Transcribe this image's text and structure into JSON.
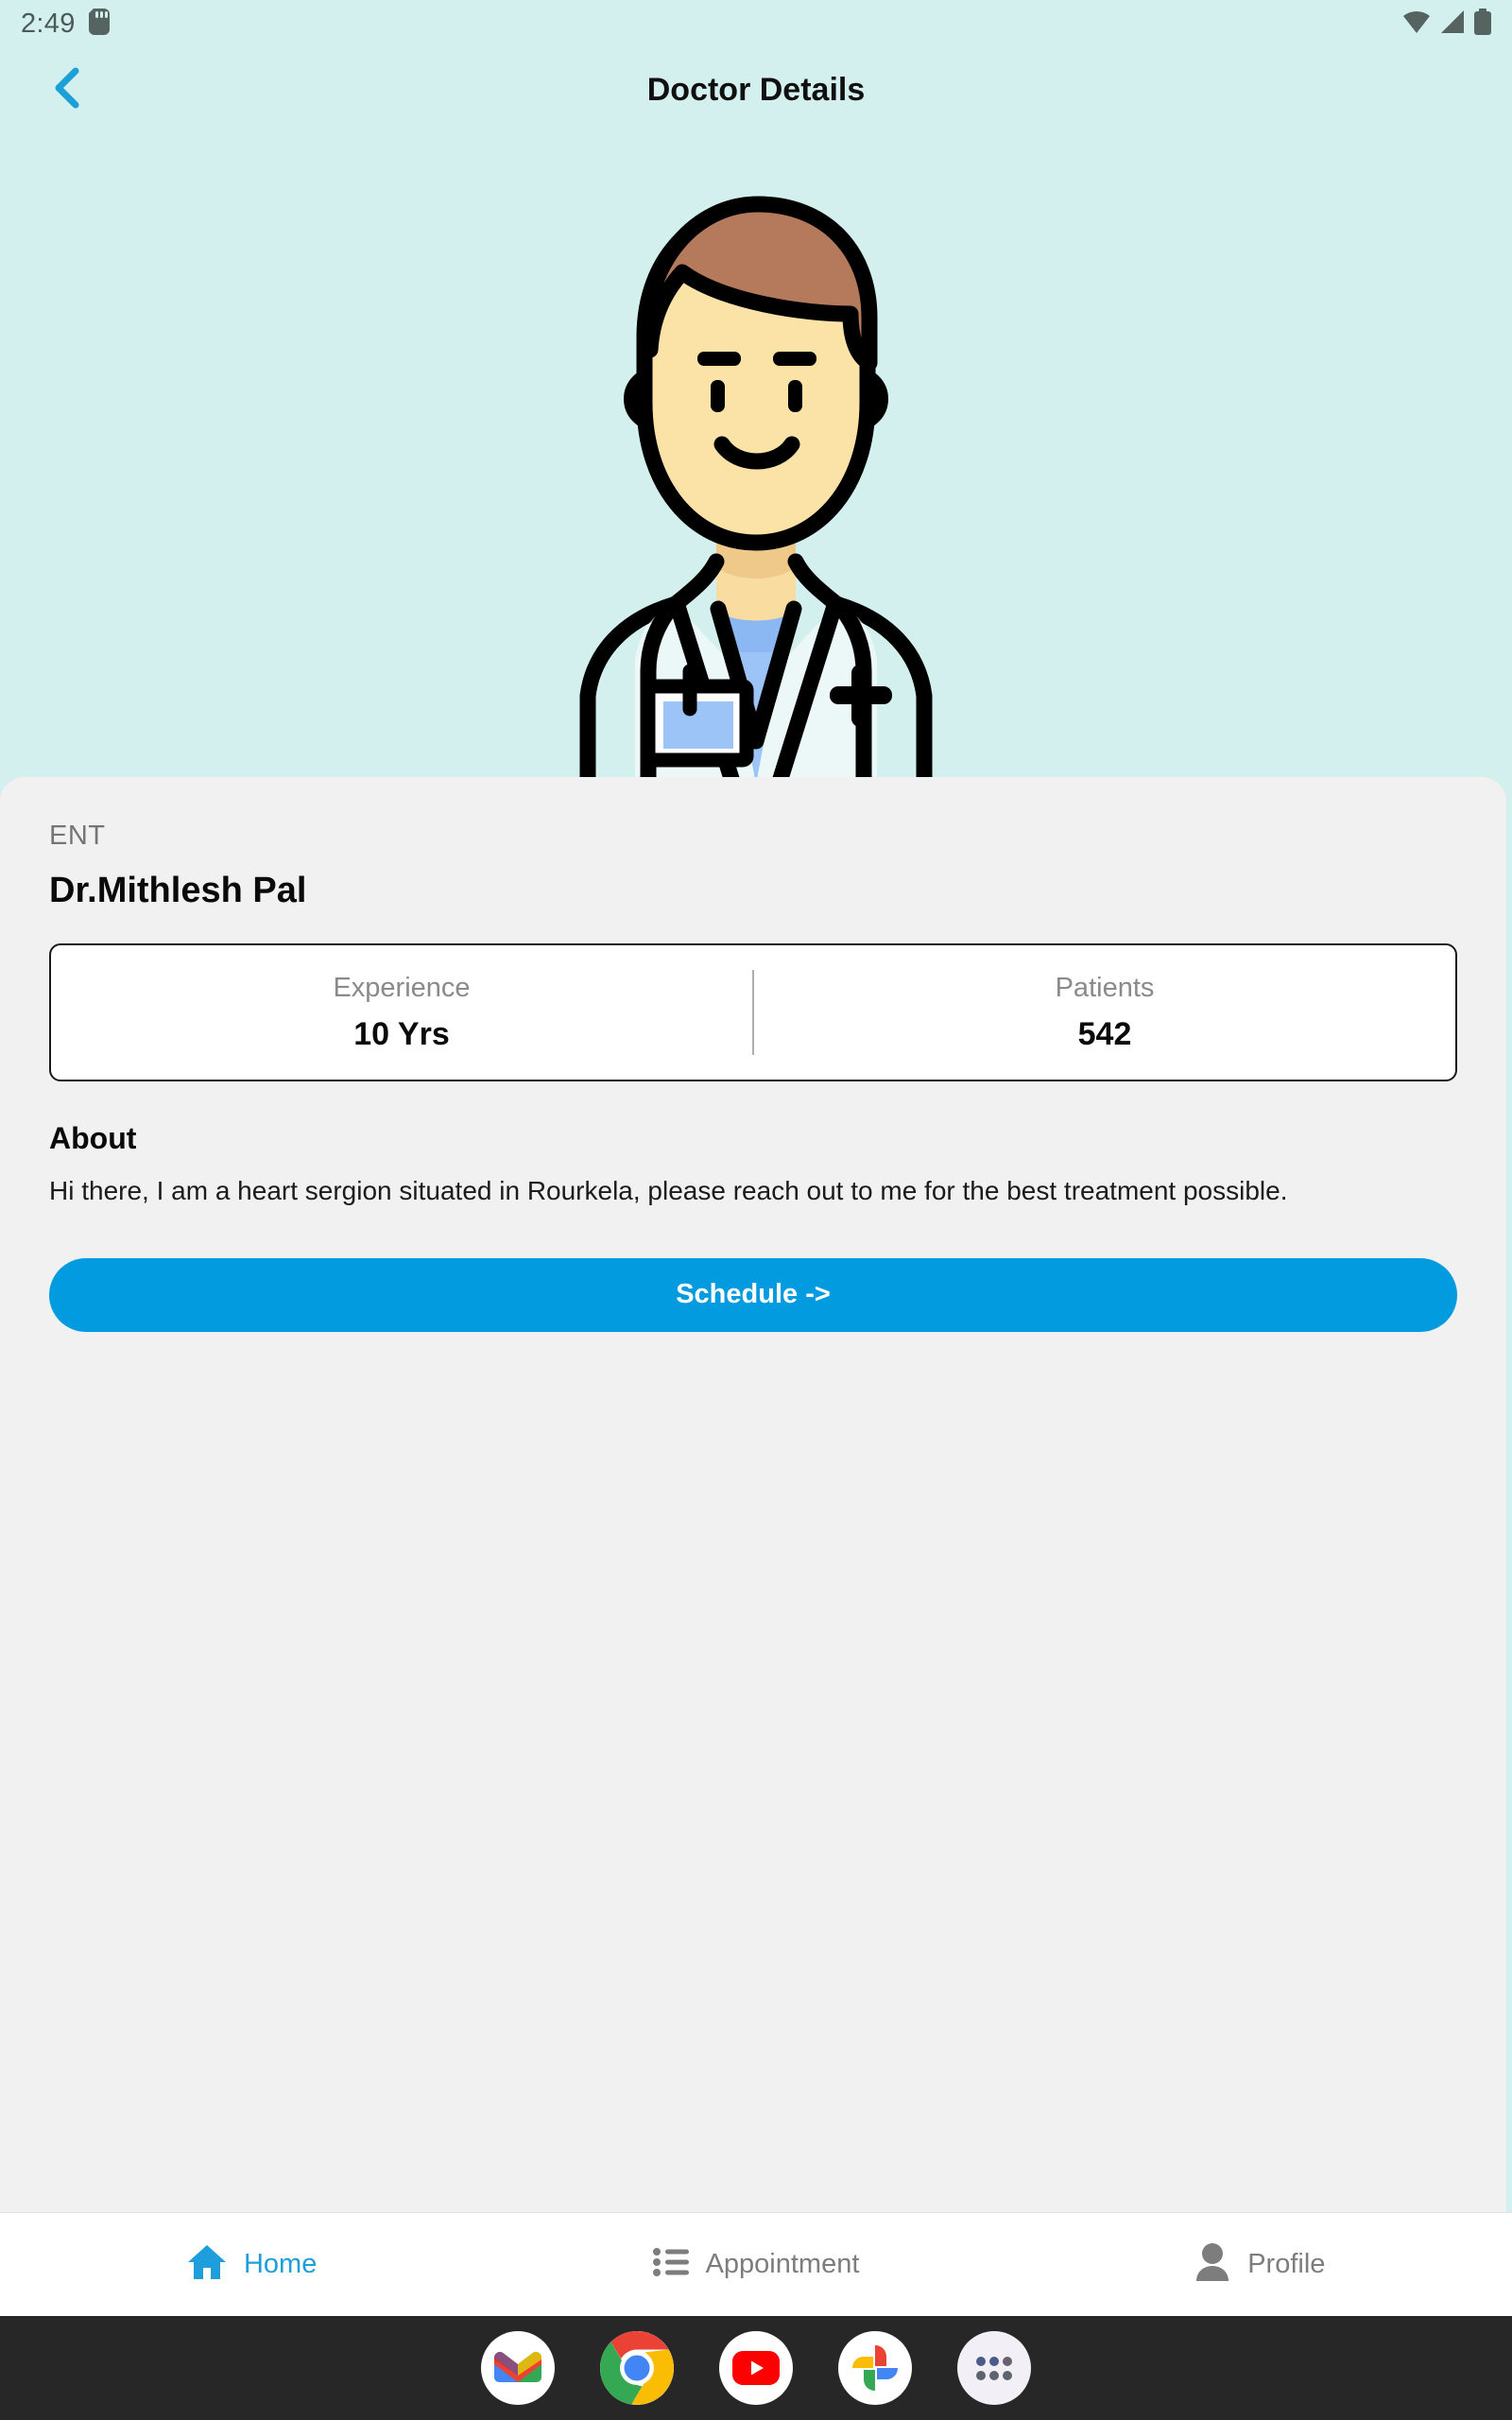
{
  "status_bar": {
    "time": "2:49",
    "icons": [
      "sd-card-icon",
      "wifi-icon",
      "signal-icon",
      "battery-icon"
    ]
  },
  "app_bar": {
    "title": "Doctor Details",
    "back_icon": "chevron-left-icon"
  },
  "hero": {
    "illustration": "doctor-avatar-illustration",
    "background_color": "#D4F0EE"
  },
  "detail": {
    "specialty": "ENT",
    "doctor_name": "Dr.Mithlesh Pal",
    "stats": [
      {
        "label": "Experience",
        "value": "10 Yrs"
      },
      {
        "label": "Patients",
        "value": "542"
      }
    ],
    "about_title": "About",
    "about_text": "Hi there, I am a heart sergion situated in Rourkela, please reach out to me for the best treatment possible.",
    "schedule_label": "Schedule ->"
  },
  "bottom_nav": {
    "items": [
      {
        "label": "Home",
        "icon": "home-icon",
        "active": true
      },
      {
        "label": "Appointment",
        "icon": "list-icon",
        "active": false
      },
      {
        "label": "Profile",
        "icon": "person-icon",
        "active": false
      }
    ]
  },
  "dock": {
    "items": [
      {
        "name": "gmail-icon"
      },
      {
        "name": "chrome-icon"
      },
      {
        "name": "youtube-icon"
      },
      {
        "name": "google-photos-icon"
      },
      {
        "name": "app-drawer-icon"
      }
    ]
  },
  "colors": {
    "accent_blue": "#039BE0",
    "nav_active": "#1E9FDB",
    "hero_teal": "#D4F0EE",
    "card_gray": "#F1F1F1"
  }
}
